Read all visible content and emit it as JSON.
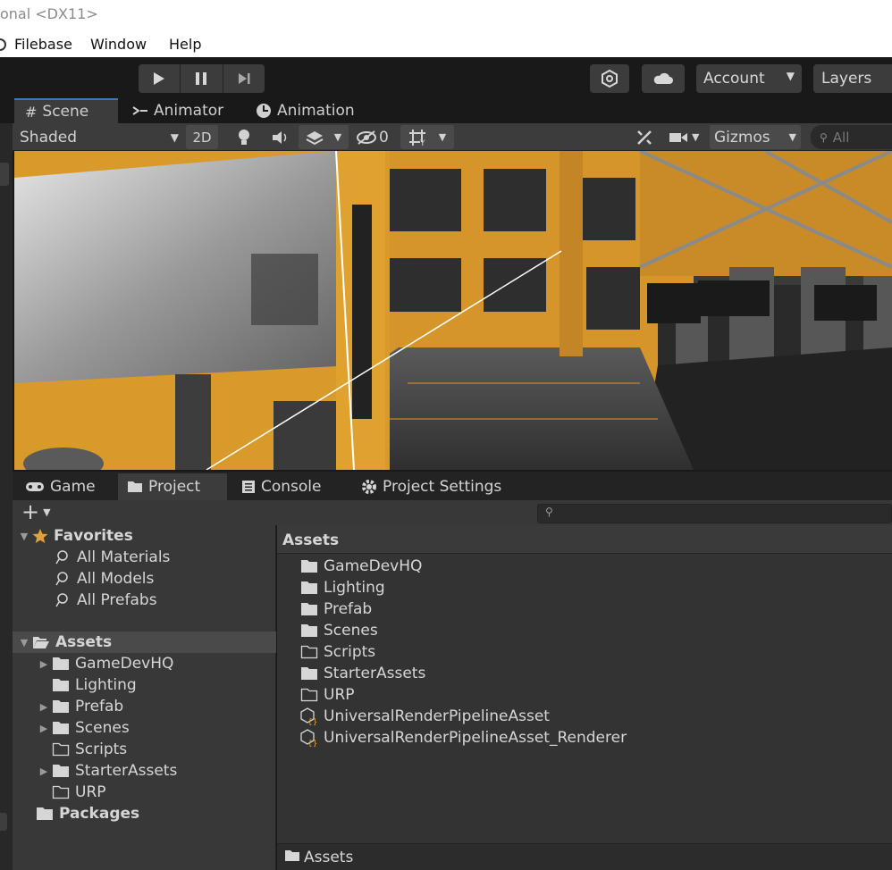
{
  "window": {
    "title": "onal <DX11>"
  },
  "menubar": {
    "items": [
      "Filebase",
      "Window",
      "Help"
    ]
  },
  "toolbar": {
    "account_label": "Account",
    "layers_label": "Layers"
  },
  "scene_tabs": [
    "Scene",
    "Animator",
    "Animation"
  ],
  "scene_toolbar": {
    "shading_mode": "Shaded",
    "toggle_2d": "2D",
    "hidden_count": "0",
    "gizmos_label": "Gizmos",
    "search_placeholder": "All"
  },
  "bottom_tabs": [
    "Game",
    "Project",
    "Console",
    "Project Settings"
  ],
  "favorites": {
    "label": "Favorites",
    "items": [
      "All Materials",
      "All Models",
      "All Prefabs"
    ]
  },
  "tree": {
    "assets_label": "Assets",
    "children": [
      "GameDevHQ",
      "Lighting",
      "Prefab",
      "Scenes",
      "Scripts",
      "StarterAssets",
      "URP"
    ],
    "packages_label": "Packages"
  },
  "content": {
    "header": "Assets",
    "items": [
      "GameDevHQ",
      "Lighting",
      "Prefab",
      "Scenes",
      "Scripts",
      "StarterAssets",
      "URP",
      "UniversalRenderPipelineAsset",
      "UniversalRenderPipelineAsset_Renderer"
    ],
    "path": "Assets"
  },
  "colors": {
    "accent": "#3a79bb",
    "scene_orange": "#e8a52c",
    "favorite_star": "#e0a23a"
  }
}
